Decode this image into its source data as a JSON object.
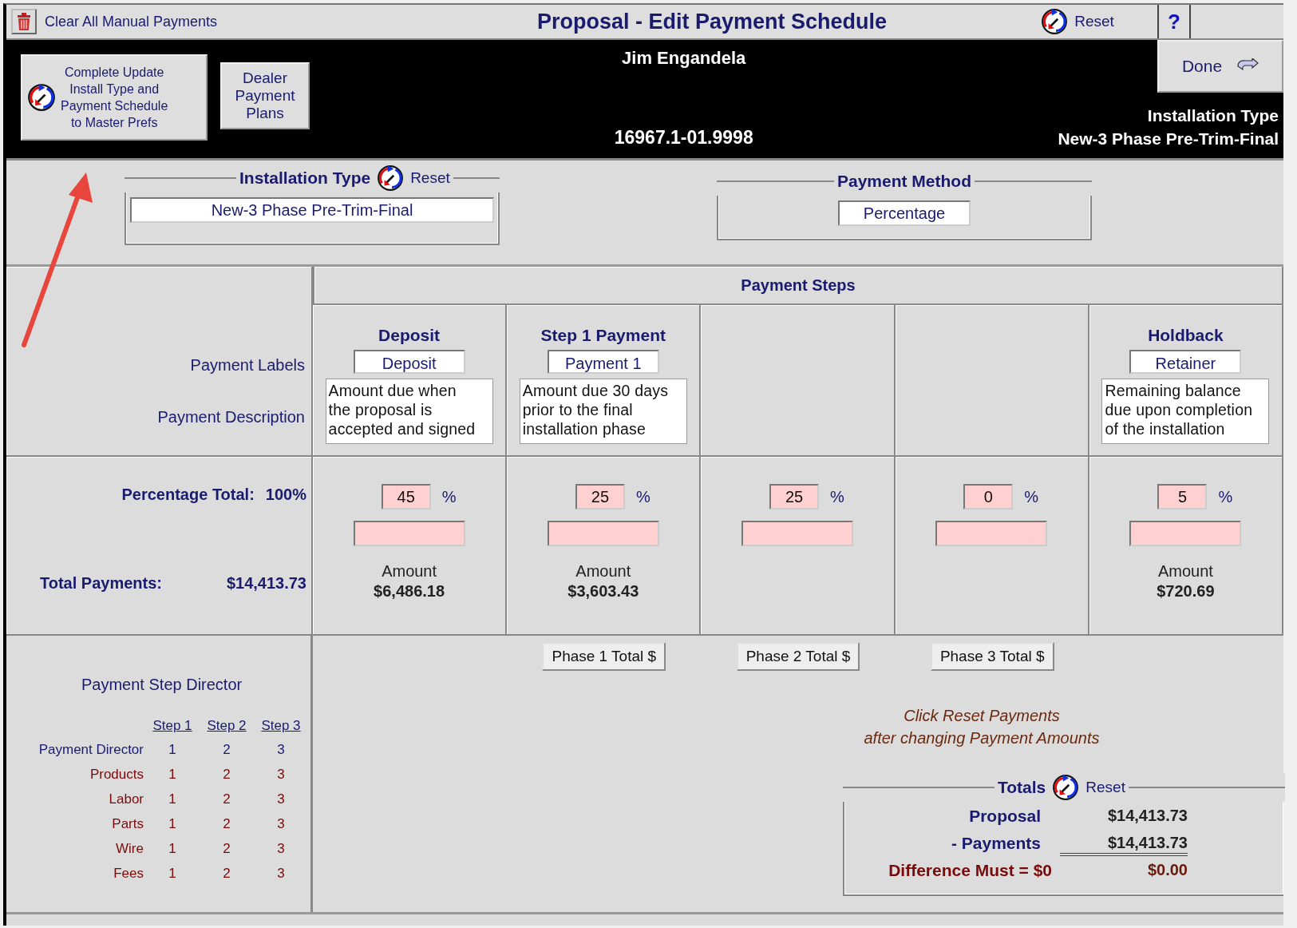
{
  "toolbar": {
    "clear_button": "Clear All Manual Payments",
    "title": "Proposal - Edit Payment Schedule",
    "reset_button": "Reset",
    "help_button": "?"
  },
  "header": {
    "update_button": "Complete Update\nInstall Type and\nPayment Schedule\nto Master Prefs",
    "dealer_button": "Dealer\nPayment\nPlans",
    "customer_name": "Jim Engandela",
    "proposal_number": "16967.1-01.9998",
    "done_button": "Done",
    "install_type_label": "Installation Type",
    "install_type_value": "New-3 Phase   Pre-Trim-Final"
  },
  "installation_type": {
    "legend": "Installation Type",
    "reset_button": "Reset",
    "value": "New-3 Phase   Pre-Trim-Final"
  },
  "payment_method": {
    "legend": "Payment Method",
    "value": "Percentage"
  },
  "payment_steps": {
    "title": "Payment Steps",
    "labels_label": "Payment Labels",
    "description_label": "Payment Description",
    "percentage_total_label": "Percentage Total:",
    "percentage_total": "100%",
    "total_payments_label": "Total Payments:",
    "total_payments": "$14,413.73",
    "steps": [
      {
        "heading": "Deposit",
        "label": "Deposit",
        "description": "Amount due when\nthe proposal is\naccepted and signed",
        "percent": "45",
        "percent_sign": "%",
        "amount_label": "Amount",
        "amount": "$6,486.18"
      },
      {
        "heading": "Step 1 Payment",
        "label": "Payment 1",
        "description": "Amount due 30 days\nprior to the final\ninstallation phase",
        "percent": "25",
        "percent_sign": "%",
        "amount_label": "Amount",
        "amount": "$3,603.43",
        "phase_button": "Phase 1 Total $"
      },
      {
        "percent": "25",
        "percent_sign": "%",
        "phase_button": "Phase 2 Total $"
      },
      {
        "percent": "0",
        "percent_sign": "%",
        "phase_button": "Phase 3 Total $"
      },
      {
        "heading": "Holdback",
        "label": "Retainer",
        "description": "Remaining balance\ndue upon completion\nof the installation",
        "percent": "5",
        "percent_sign": "%",
        "amount_label": "Amount",
        "amount": "$720.69"
      }
    ]
  },
  "director": {
    "title": "Payment Step Director",
    "columns": [
      "Step 1",
      "Step 2",
      "Step 3"
    ],
    "rows": [
      {
        "name": "Payment Director",
        "kind": "header",
        "values": [
          "1",
          "2",
          "3"
        ]
      },
      {
        "name": "Products",
        "kind": "item",
        "values": [
          "1",
          "2",
          "3"
        ]
      },
      {
        "name": "Labor",
        "kind": "item",
        "values": [
          "1",
          "2",
          "3"
        ]
      },
      {
        "name": "Parts",
        "kind": "item",
        "values": [
          "1",
          "2",
          "3"
        ]
      },
      {
        "name": "Wire",
        "kind": "item",
        "values": [
          "1",
          "2",
          "3"
        ]
      },
      {
        "name": "Fees",
        "kind": "item",
        "values": [
          "1",
          "2",
          "3"
        ]
      }
    ]
  },
  "note": "Click Reset Payments\nafter changing Payment Amounts",
  "totals": {
    "legend": "Totals",
    "reset_button": "Reset",
    "rows": [
      {
        "label": "Proposal",
        "value": "$14,413.73",
        "kind": "total"
      },
      {
        "label": "- Payments",
        "value": "$14,413.73",
        "kind": "subtract"
      },
      {
        "label": "Difference Must = $0",
        "value": "$0.00",
        "kind": "difference"
      }
    ]
  }
}
